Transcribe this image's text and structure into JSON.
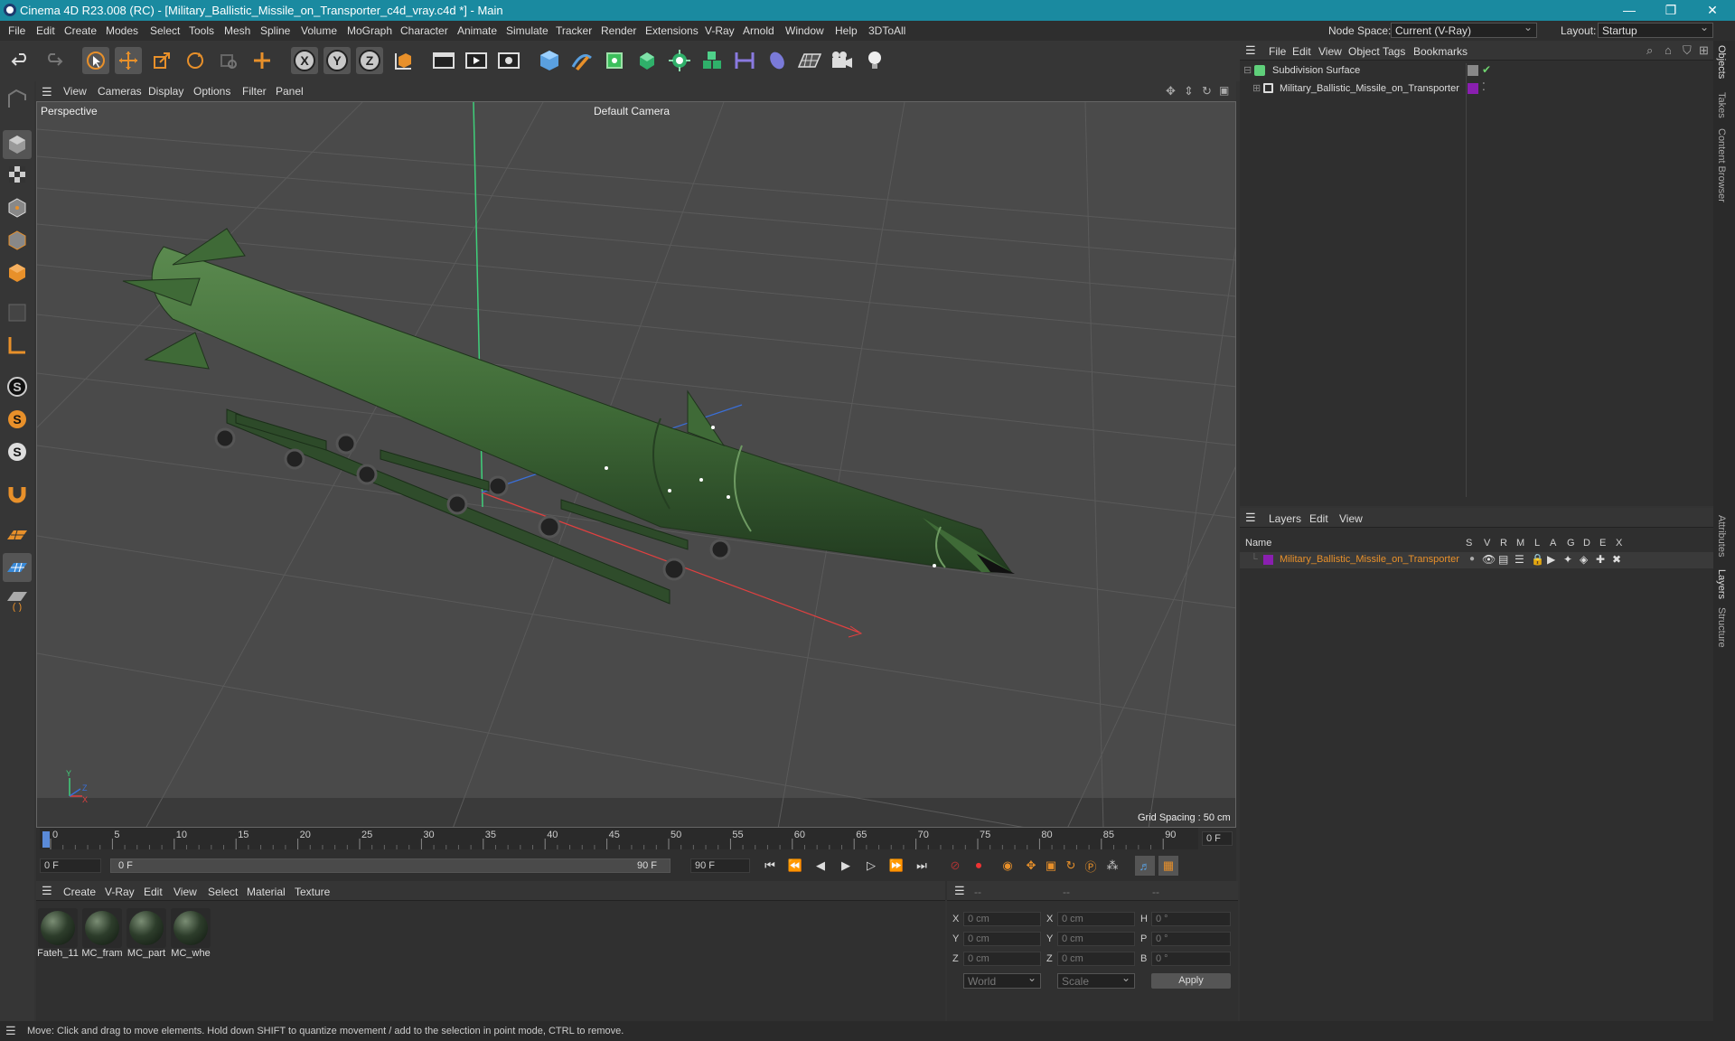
{
  "window": {
    "title": "Cinema 4D R23.008 (RC) - [Military_Ballistic_Missile_on_Transporter_c4d_vray.c4d *] - Main",
    "minimize": "—",
    "restore": "❐",
    "close": "✕"
  },
  "menubar": {
    "items": [
      "File",
      "Edit",
      "Create",
      "Modes",
      "Select",
      "Tools",
      "Mesh",
      "Spline",
      "Volume",
      "MoGraph",
      "Character",
      "Animate",
      "Simulate",
      "Tracker",
      "Render",
      "Extensions",
      "V-Ray",
      "Arnold",
      "Window",
      "Help",
      "3DToAll"
    ],
    "node_space_label": "Node Space:",
    "node_space_value": "Current (V-Ray)",
    "layout_label": "Layout:",
    "layout_value": "Startup"
  },
  "toolbar": {
    "icons": [
      "undo-icon",
      "redo-icon",
      "select-icon",
      "move-icon",
      "scale-icon",
      "rotate-icon",
      "live-select-icon",
      "add-icon",
      "axis-x-icon",
      "axis-y-icon",
      "axis-z-icon",
      "coord-system-icon",
      "render-region-icon",
      "render-view-icon",
      "render-settings-icon",
      "cube-icon",
      "pen-icon",
      "subdivision-icon",
      "extrude-icon",
      "cloner-icon",
      "array-icon",
      "symmetry-icon",
      "deformer-icon",
      "floor-icon",
      "camera-icon",
      "light-icon"
    ],
    "x": "X",
    "y": "Y",
    "z": "Z"
  },
  "viewport": {
    "menu": [
      "View",
      "Cameras",
      "Display",
      "Options",
      "Filter",
      "Panel"
    ],
    "label": "Perspective",
    "camera": "Default Camera",
    "grid_spacing": "Grid Spacing : 50 cm",
    "axis_y": "Y",
    "axis_z": "Z",
    "axis_x": "X"
  },
  "timeline": {
    "ticks": [
      "0",
      "5",
      "10",
      "15",
      "20",
      "25",
      "30",
      "35",
      "40",
      "45",
      "50",
      "55",
      "60",
      "65",
      "70",
      "75",
      "80",
      "85",
      "90"
    ],
    "current_frame": "0 F",
    "start_field": "0 F",
    "range_start": "0 F",
    "range_end": "90 F",
    "end_field": "90 F",
    "right_field": "0 F",
    "playhead_position": 0
  },
  "materials": {
    "menu": [
      "Create",
      "V-Ray",
      "Edit",
      "View",
      "Select",
      "Material",
      "Texture"
    ],
    "items": [
      "Fateh_11",
      "MC_fram",
      "MC_part",
      "MC_whe"
    ]
  },
  "coords": {
    "headers": [
      "--",
      "--",
      "--"
    ],
    "rows": [
      {
        "a": "X",
        "av": "0 cm",
        "b": "X",
        "bv": "0 cm",
        "c": "H",
        "cv": "0 °"
      },
      {
        "a": "Y",
        "av": "0 cm",
        "b": "Y",
        "bv": "0 cm",
        "c": "P",
        "cv": "0 °"
      },
      {
        "a": "Z",
        "av": "0 cm",
        "b": "Z",
        "bv": "0 cm",
        "c": "B",
        "cv": "0 °"
      }
    ],
    "world": "World",
    "scale": "Scale",
    "apply": "Apply"
  },
  "objects": {
    "menu": [
      "File",
      "Edit",
      "View",
      "Object",
      "Tags",
      "Bookmarks"
    ],
    "tree": [
      "Subdivision Surface",
      "Military_Ballistic_Missile_on_Transporter"
    ]
  },
  "layers": {
    "menu": [
      "Layers",
      "Edit",
      "View"
    ],
    "name_header": "Name",
    "flags": [
      "S",
      "V",
      "R",
      "M",
      "L",
      "A",
      "G",
      "D",
      "E",
      "X"
    ],
    "rows": [
      "Military_Ballistic_Missile_on_Transporter"
    ],
    "layer_color": "#8a1fb0"
  },
  "sidetabs": [
    "Objects",
    "Takes",
    "Content Browser",
    "Attributes",
    "Layers",
    "Structure"
  ],
  "status": "Move: Click and drag to move elements. Hold down SHIFT to quantize movement / add to the selection in point mode, CTRL to remove.",
  "colors": {
    "titlebar": "#1a8aa0",
    "missile": "#3e6a36",
    "accent_orange": "#e8902a",
    "object_green": "#7ec850"
  }
}
